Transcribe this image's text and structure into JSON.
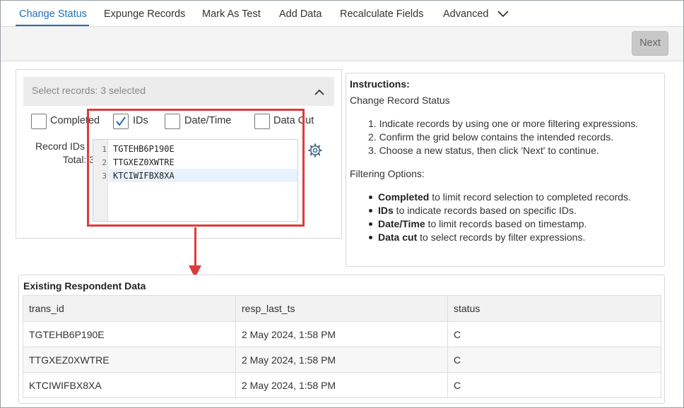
{
  "tabs": [
    {
      "label": "Change Status",
      "active": true
    },
    {
      "label": "Expunge Records"
    },
    {
      "label": "Mark As Test"
    },
    {
      "label": "Add Data"
    },
    {
      "label": "Recalculate Fields"
    },
    {
      "label": "Advanced"
    }
  ],
  "toolbar": {
    "next_label": "Next"
  },
  "selector": {
    "header": "Select records: 3 selected",
    "filters": [
      {
        "label": "Completed",
        "checked": false
      },
      {
        "label": "IDs",
        "checked": true
      },
      {
        "label": "Date/Time",
        "checked": false
      },
      {
        "label": "Data Cut",
        "checked": false
      }
    ],
    "record_ids_label": "Record IDs",
    "total_label": "Total: 3",
    "lines": [
      {
        "num": "1",
        "text": "TGTEHB6P190E"
      },
      {
        "num": "2",
        "text": "TTGXEZ0XWTRE"
      },
      {
        "num": "3",
        "text": "KTCIWIFBX8XA"
      }
    ]
  },
  "instructions": {
    "title": "Instructions:",
    "subtitle": "Change Record Status",
    "steps": [
      "1. Indicate records by using one or more filtering expressions.",
      "2. Confirm the grid below contains the intended records.",
      "3. Choose a new status, then click 'Next' to continue."
    ],
    "options_title": "Filtering Options:",
    "options": [
      {
        "term": "Completed",
        "desc": " to limit record selection to completed records."
      },
      {
        "term": "IDs",
        "desc": " to indicate records based on specific IDs."
      },
      {
        "term": "Date/Time",
        "desc": " to limit records based on timestamp."
      },
      {
        "term": "Data cut",
        "desc": " to select records by filter expressions."
      }
    ]
  },
  "grid": {
    "title": "Existing Respondent Data",
    "columns": [
      "trans_id",
      "resp_last_ts",
      "status"
    ],
    "rows": [
      [
        "TGTEHB6P190E",
        "2 May 2024, 1:58 PM",
        "C"
      ],
      [
        "TTGXEZ0XWTRE",
        "2 May 2024, 1:58 PM",
        "C"
      ],
      [
        "KTCIWIFBX8XA",
        "2 May 2024, 1:58 PM",
        "C"
      ]
    ]
  },
  "colors": {
    "accent": "#1f6fb6",
    "highlight": "#e03a3a"
  }
}
